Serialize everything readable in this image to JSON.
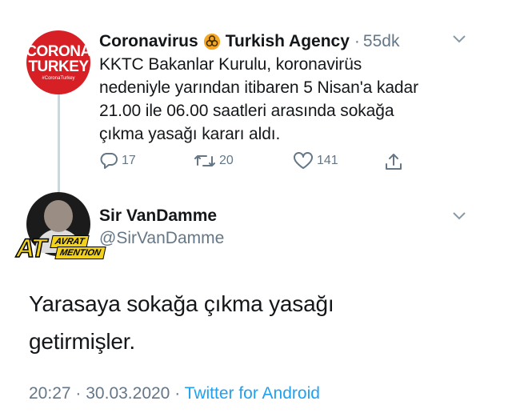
{
  "colors": {
    "text": "#14171a",
    "secondary": "#657786",
    "link": "#1da1f2",
    "thread_line": "#ccd6dd",
    "brand_red": "#d71f26",
    "badge_yellow": "#f2d11b"
  },
  "parent_tweet": {
    "avatar": {
      "line1": "CORONA",
      "line2": "TURKEY",
      "line3": "#CoronaTurkey"
    },
    "name_part1": "Coronavirus",
    "name_icon": "biohazard-icon",
    "name_part2": "Turkish Agency",
    "separator": "·",
    "time": "55dk",
    "text": "KKTC Bakanlar Kurulu, koronavirüs nedeniyle yarından itibaren 5 Nisan'a kadar 21.00 ile 06.00 saatleri arasında sokağa çıkma yasağı kararı aldı.",
    "actions": {
      "reply_icon": "reply-icon",
      "reply_count": "17",
      "retweet_icon": "retweet-icon",
      "retweet_count": "20",
      "like_icon": "heart-icon",
      "like_count": "141",
      "share_icon": "share-icon"
    }
  },
  "reply_tweet": {
    "name": "Sir VanDamme",
    "handle": "@SirVanDamme",
    "badge": {
      "at": "AT",
      "line1": "AVRAT",
      "line2": "MENTION"
    },
    "text_line1": "Yarasaya sokağa çıkma yasağı",
    "text_line2": "getirmişler.",
    "time": "20:27",
    "dot1": "·",
    "date": "30.03.2020",
    "dot2": "·",
    "source": "Twitter for Android"
  }
}
